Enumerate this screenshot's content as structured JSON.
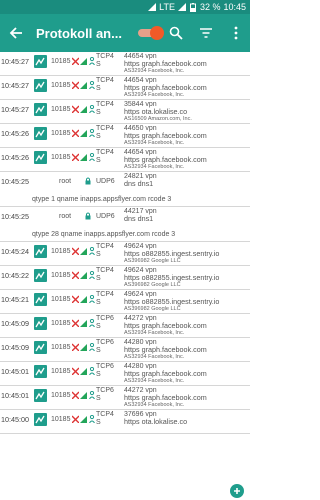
{
  "status": {
    "network": "LTE",
    "battery": "32 %",
    "time": "10:45"
  },
  "appbar": {
    "title": "Protokoll an...",
    "back_icon": "arrow-back-icon",
    "actions": [
      "search-icon",
      "filter-icon",
      "more-vert-icon"
    ],
    "toggle_on": true
  },
  "colors": {
    "primary": "#1f9d8c",
    "status": "#1a8c7e",
    "toggle_knob": "#f05a28",
    "allowed": "#23a55a",
    "blocked": "#d33"
  },
  "rows": [
    {
      "time": "10:45:27",
      "uid": "10185",
      "proto": [
        "TCP4",
        "S"
      ],
      "port": "44654 vpn",
      "host": "https graph.facebook.com",
      "org": "AS32934 Facebook, Inc."
    },
    {
      "time": "10:45:27",
      "uid": "10185",
      "proto": [
        "TCP4",
        "S"
      ],
      "port": "44654 vpn",
      "host": "https graph.facebook.com",
      "org": "AS32934 Facebook, Inc."
    },
    {
      "time": "10:45:27",
      "uid": "10185",
      "proto": [
        "TCP4",
        "S"
      ],
      "port": "35844 vpn",
      "host": "https ota.lokalise.co",
      "org": "AS16509 Amazon.com, Inc."
    },
    {
      "time": "10:45:26",
      "uid": "10185",
      "proto": [
        "TCP4",
        "S"
      ],
      "port": "44650 vpn",
      "host": "https graph.facebook.com",
      "org": "AS32934 Facebook, Inc."
    },
    {
      "time": "10:45:26",
      "uid": "10185",
      "proto": [
        "TCP4",
        "S"
      ],
      "port": "44654 vpn",
      "host": "https graph.facebook.com",
      "org": "AS32934 Facebook, Inc."
    },
    {
      "time": "10:45:25",
      "uid": "root",
      "proto": [
        "UDP6"
      ],
      "port": "24821 vpn",
      "host": "dns dns1",
      "org": "",
      "query": "qtype 1 qname inapps.appsflyer.com rcode 3"
    },
    {
      "time": "10:45:25",
      "uid": "root",
      "proto": [
        "UDP6"
      ],
      "port": "44217 vpn",
      "host": "dns dns1",
      "org": "",
      "query": "qtype 28 qname inapps.appsflyer.com rcode 3"
    },
    {
      "time": "10:45:24",
      "uid": "10185",
      "proto": [
        "TCP4",
        "S"
      ],
      "port": "49624 vpn",
      "host": "https o882855.ingest.sentry.io",
      "org": "AS396982 Google LLC"
    },
    {
      "time": "10:45:22",
      "uid": "10185",
      "proto": [
        "TCP4",
        "S"
      ],
      "port": "49624 vpn",
      "host": "https o882855.ingest.sentry.io",
      "org": "AS396982 Google LLC"
    },
    {
      "time": "10:45:21",
      "uid": "10185",
      "proto": [
        "TCP4",
        "S"
      ],
      "port": "49624 vpn",
      "host": "https o882855.ingest.sentry.io",
      "org": "AS396982 Google LLC"
    },
    {
      "time": "10:45:09",
      "uid": "10185",
      "proto": [
        "TCP6",
        "S"
      ],
      "port": "44272 vpn",
      "host": "https graph.facebook.com",
      "org": "AS32934 Facebook, Inc."
    },
    {
      "time": "10:45:09",
      "uid": "10185",
      "proto": [
        "TCP6",
        "S"
      ],
      "port": "44280 vpn",
      "host": "https graph.facebook.com",
      "org": "AS32934 Facebook, Inc."
    },
    {
      "time": "10:45:01",
      "uid": "10185",
      "proto": [
        "TCP6",
        "S"
      ],
      "port": "44280 vpn",
      "host": "https graph.facebook.com",
      "org": "AS32934 Facebook, Inc."
    },
    {
      "time": "10:45:01",
      "uid": "10185",
      "proto": [
        "TCP6",
        "S"
      ],
      "port": "44272 vpn",
      "host": "https graph.facebook.com",
      "org": "AS32934 Facebook, Inc."
    },
    {
      "time": "10:45:00",
      "uid": "10185",
      "proto": [
        "TCP4",
        "S"
      ],
      "port": "37696 vpn",
      "host": "https ota.lokalise.co",
      "org": ""
    }
  ]
}
